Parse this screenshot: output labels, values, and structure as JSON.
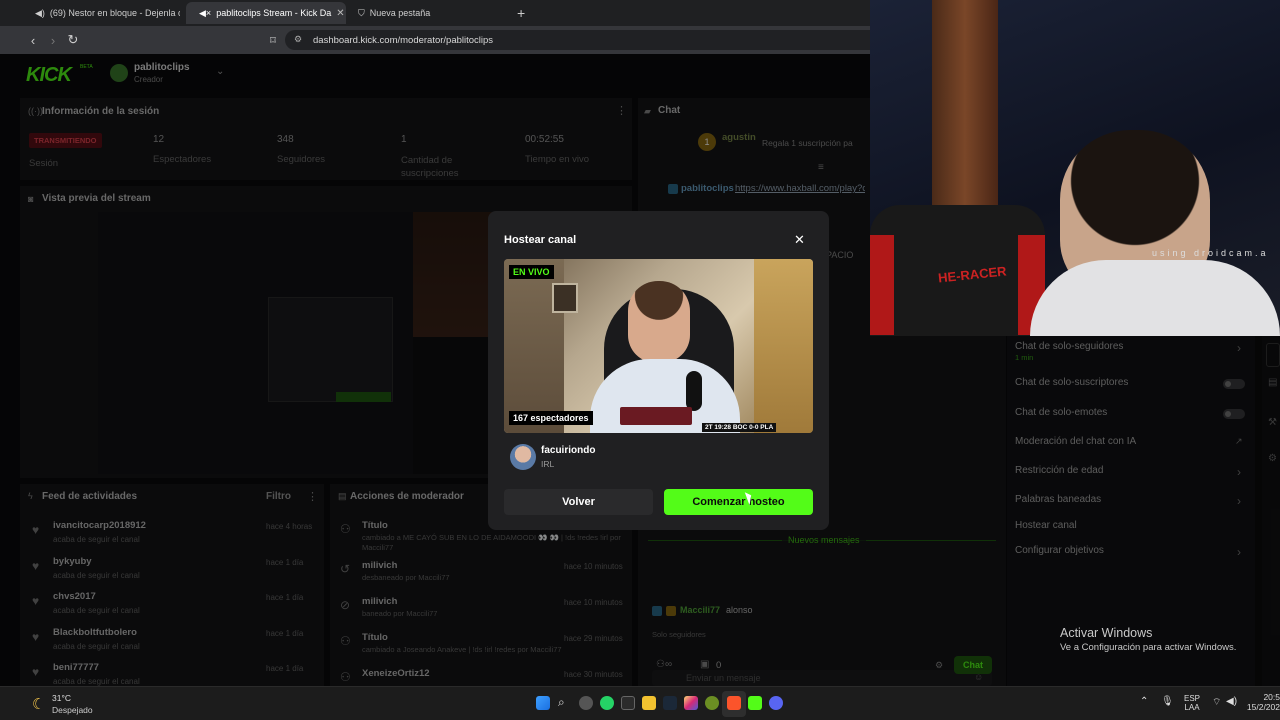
{
  "browser": {
    "tabs": [
      {
        "label": "(69) Nestor en bloque - Dejenla c"
      },
      {
        "label": "pablitoclips Stream - Kick Da"
      },
      {
        "label": "Nueva pestaña"
      }
    ],
    "url": "dashboard.kick.com/moderator/pablitoclips"
  },
  "header": {
    "logo": "KICK",
    "logo_badge": "BETA",
    "channel_name": "pablitoclips",
    "channel_role": "Creador"
  },
  "session": {
    "title": "Información de la sesión",
    "badge": "TRANSMITIENDO",
    "session_label": "Sesión",
    "stats": [
      {
        "value": "12",
        "label": "Espectadores"
      },
      {
        "value": "348",
        "label": "Seguidores"
      },
      {
        "value": "1",
        "label": "Cantidad de suscripciones"
      },
      {
        "value": "00:52:55",
        "label": "Tiempo en vivo"
      }
    ]
  },
  "preview_section": {
    "title": "Vista previa del stream"
  },
  "chat": {
    "title": "Chat",
    "pinned_user": "agustin",
    "pinned_text": "Regala 1 suscripción pa",
    "message_user": "pablitoclips",
    "message_link": "https://www.haxball.com/play?c",
    "fragment": "PACIO",
    "new_messages": "Nuevos mensajes",
    "last_user": "Maccili77",
    "last_text": "alonso",
    "followers_only": "Solo seguidores",
    "input_placeholder": "Enviar un mensaje",
    "count": "0",
    "chat_button": "Chat"
  },
  "settings": {
    "items": [
      {
        "label": "Chat de solo-seguidores",
        "sub": "1 min"
      },
      {
        "label": "Chat de solo-suscriptores"
      },
      {
        "label": "Chat de solo-emotes"
      },
      {
        "label": "Moderación del chat con IA"
      },
      {
        "label": "Restricción de edad"
      },
      {
        "label": "Palabras baneadas"
      },
      {
        "label": "Hostear canal"
      },
      {
        "label": "Configurar objetivos"
      }
    ]
  },
  "activity": {
    "title": "Feed de actividades",
    "filter": "Filtro",
    "items": [
      {
        "user": "ivancitocarp2018912",
        "text": "acaba de seguir el canal",
        "time": "hace 4 horas"
      },
      {
        "user": "bykyuby",
        "text": "acaba de seguir el canal",
        "time": "hace 1 día"
      },
      {
        "user": "chvs2017",
        "text": "acaba de seguir el canal",
        "time": "hace 1 día"
      },
      {
        "user": "Blackboltfutbolero",
        "text": "acaba de seguir el canal",
        "time": "hace 1 día"
      },
      {
        "user": "beni77777",
        "text": "acaba de seguir el canal",
        "time": "hace 1 día"
      }
    ]
  },
  "mod_actions": {
    "title": "Acciones de moderador",
    "items": [
      {
        "title": "Título",
        "detail": "cambiado a ME CAYÓ SUB EN LO DE AIDAMOODI 👀 👀 | !ds !redes !irl por Maccili77",
        "time": ""
      },
      {
        "title": "milivich",
        "detail": "desbaneado por Maccili77",
        "time": "hace 10 minutos"
      },
      {
        "title": "milivich",
        "detail": "baneado por Maccili77",
        "time": "hace 10 minutos"
      },
      {
        "title": "Título",
        "detail": "cambiado a Joseando Anakeve | !ds !irl !redes por Maccili77",
        "time": "hace 29 minutos"
      },
      {
        "title": "XeneizeOrtiz12",
        "detail": "",
        "time": "hace 30 minutos"
      }
    ]
  },
  "modal": {
    "title": "Hostear canal",
    "live_badge": "EN VIVO",
    "viewers": "167 espectadores",
    "overlay_score": "2T 19:28  BOC 0-0 PLA",
    "channel": "facuiriondo",
    "category": "IRL",
    "back_button": "Volver",
    "start_button": "Comenzar hosteo"
  },
  "webcam": {
    "watermark": "using droidcam.a",
    "chair_brand": "HE-RACER"
  },
  "windows_notice": {
    "title": "Activar Windows",
    "text": "Ve a Configuración para activar Windows."
  },
  "taskbar": {
    "temperature": "31°C",
    "weather": "Despejado",
    "lang_top": "ESP",
    "lang_bottom": "LAA",
    "time": "20:5",
    "date": "15/2/202"
  },
  "colors": {
    "accent": "#53fc18",
    "live_red": "#e01e2b",
    "modal_bg": "#202022"
  }
}
